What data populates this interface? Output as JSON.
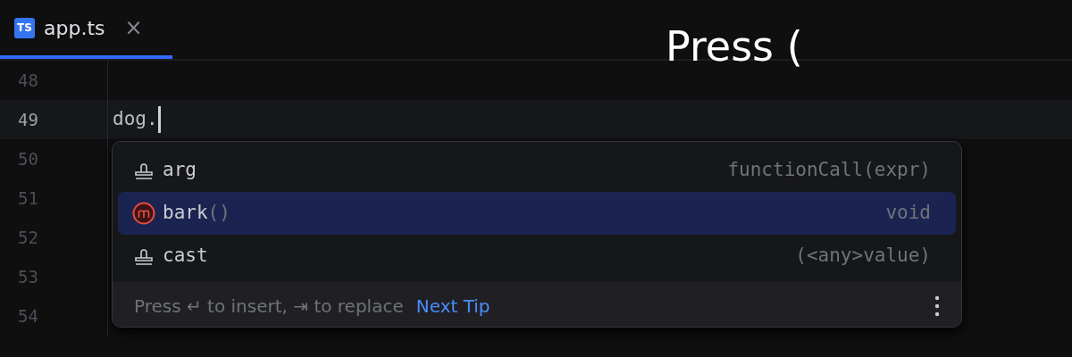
{
  "tab": {
    "file_badge": "TS",
    "label": "app.ts",
    "close": "×",
    "selected": true
  },
  "caption": "Press (",
  "gutter": [
    {
      "line": "48",
      "current": false
    },
    {
      "line": "49",
      "current": true
    },
    {
      "line": "50",
      "current": false
    },
    {
      "line": "51",
      "current": false
    },
    {
      "line": "52",
      "current": false
    },
    {
      "line": "53",
      "current": false
    },
    {
      "line": "54",
      "current": false
    }
  ],
  "code_line": "dog.",
  "completion": {
    "items": [
      {
        "kind": "template",
        "name": "arg",
        "type": "functionCall(expr)",
        "selected": false
      },
      {
        "kind": "method",
        "name": "bark",
        "suffix": "()",
        "type": "void",
        "selected": true
      },
      {
        "kind": "template",
        "name": "cast",
        "type": "(<any>value)",
        "selected": false
      }
    ],
    "hint": "Press ↵ to insert, ⇥ to replace",
    "link": "Next Tip"
  }
}
